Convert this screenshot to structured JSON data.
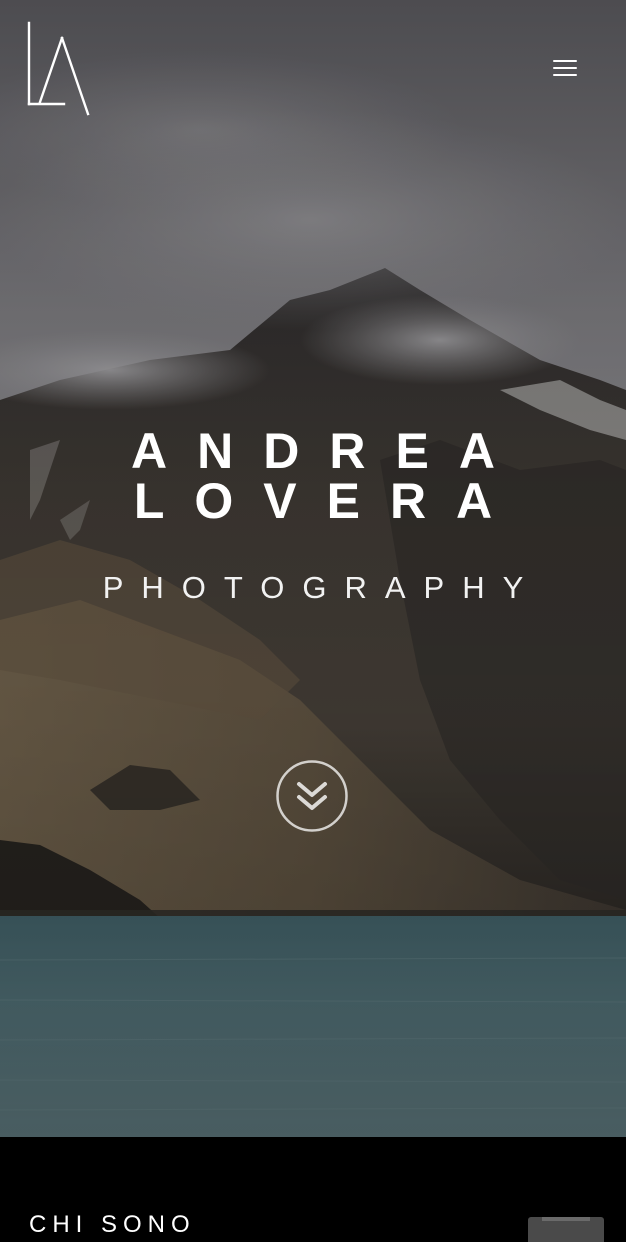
{
  "header": {
    "logo_icon": "al-monogram-logo",
    "menu_icon": "hamburger-menu-icon"
  },
  "hero": {
    "title_line1": "ANDREA",
    "title_line2": "LOVERA",
    "subtitle": "PHOTOGRAPHY",
    "scroll_icon": "double-chevron-down-icon"
  },
  "about": {
    "heading": "CHI SONO"
  },
  "colors": {
    "text": "#ffffff",
    "background": "#000000",
    "lake": "#4f6e75",
    "sky": "#6f6e72"
  }
}
